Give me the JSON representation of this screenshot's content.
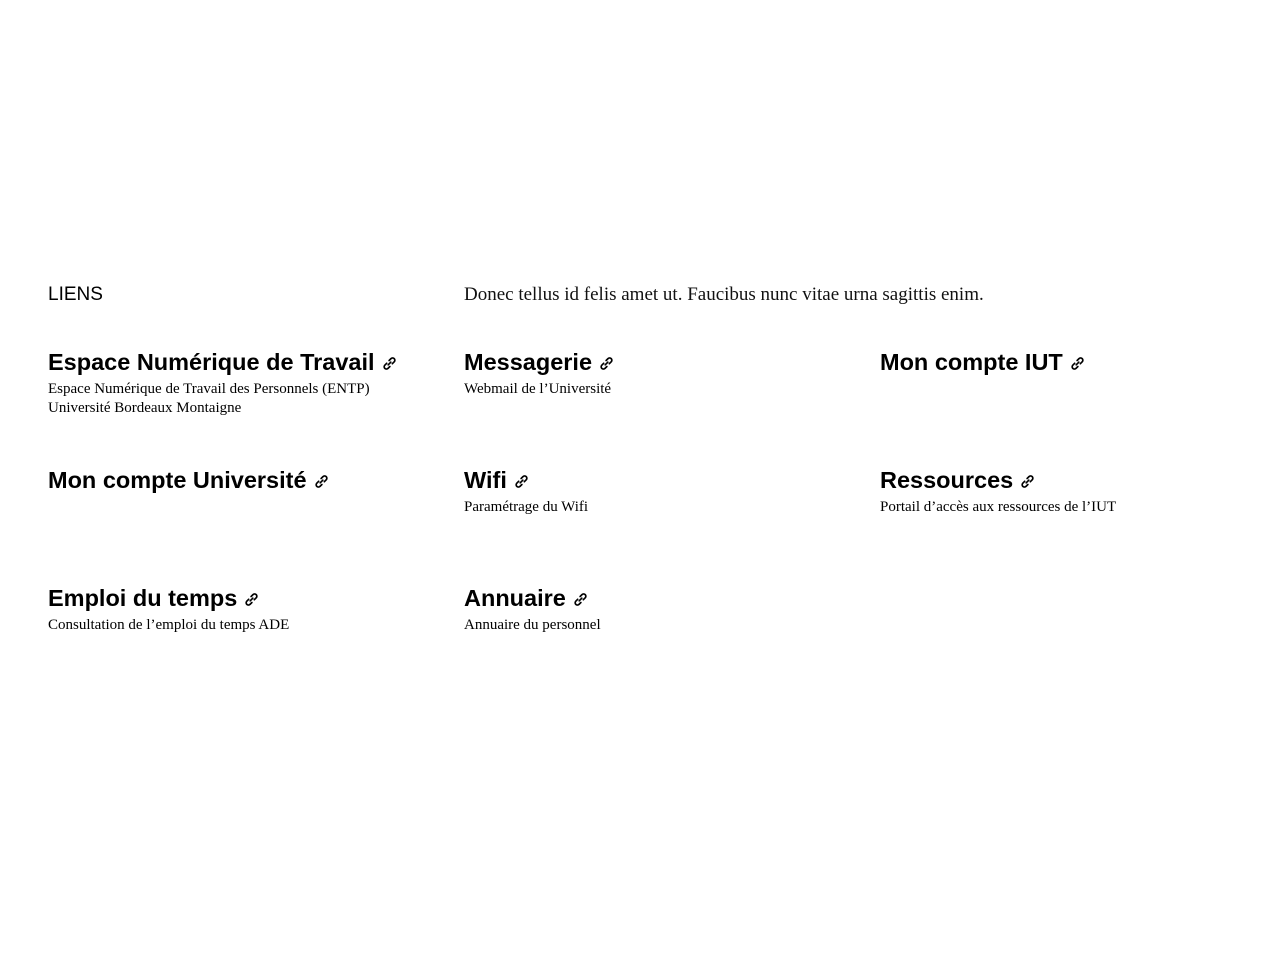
{
  "section": {
    "title": "LIENS",
    "intro": "Donec tellus id felis amet ut. Faucibus nunc vitae urna sagittis enim."
  },
  "links": [
    {
      "label": "Espace Numérique de Travail",
      "description": "Espace Numérique de Travail des Personnels (ENTP)\nUniversité Bordeaux Montaigne",
      "icon": "link-icon"
    },
    {
      "label": "Messagerie",
      "description": "Webmail de l’Université",
      "icon": "link-icon"
    },
    {
      "label": "Mon compte IUT",
      "description": "",
      "icon": "link-icon"
    },
    {
      "label": "Mon compte Université",
      "description": "",
      "icon": "link-icon"
    },
    {
      "label": "Wifi",
      "description": "Paramétrage du Wifi",
      "icon": "link-icon"
    },
    {
      "label": "Ressources",
      "description": "Portail d’accès aux ressources de l’IUT",
      "icon": "link-icon"
    },
    {
      "label": "Emploi du temps",
      "description": "Consultation de l’emploi du temps ADE",
      "icon": "link-icon"
    },
    {
      "label": "Annuaire",
      "description": "Annuaire du personnel",
      "icon": "link-icon"
    }
  ]
}
